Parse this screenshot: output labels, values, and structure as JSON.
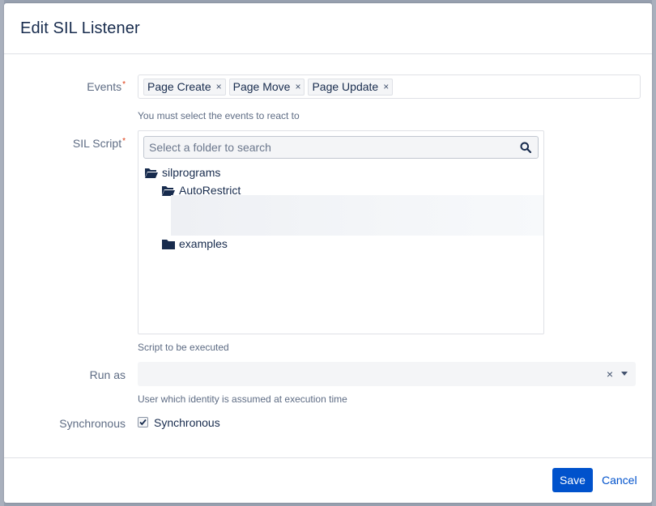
{
  "dialog": {
    "title": "Edit SIL Listener"
  },
  "events": {
    "label": "Events",
    "required_mark": "*",
    "tags": [
      {
        "label": "Page Create",
        "remove": "×"
      },
      {
        "label": "Page Move",
        "remove": "×"
      },
      {
        "label": "Page Update",
        "remove": "×"
      }
    ],
    "help": "You must select the events to react to"
  },
  "sil_script": {
    "label": "SIL Script",
    "required_mark": "*",
    "search_placeholder": "Select a folder to search",
    "search_icon": "search-icon",
    "tree": [
      {
        "label": "silprograms",
        "icon": "folder-open-icon"
      },
      {
        "label": "AutoRestrict",
        "icon": "folder-open-icon"
      },
      {
        "label": "examples",
        "icon": "folder-closed-icon"
      }
    ],
    "help": "Script to be executed"
  },
  "run_as": {
    "label": "Run as",
    "value": "",
    "clear": "×",
    "help": "User which identity is assumed at execution time"
  },
  "synchronous": {
    "label": "Synchronous",
    "checkbox_label": "Synchronous",
    "checked": true
  },
  "footer": {
    "save_label": "Save",
    "cancel_label": "Cancel"
  },
  "colors": {
    "primary": "#0052cc",
    "required": "#de350b",
    "overlay": "#97a0af"
  }
}
